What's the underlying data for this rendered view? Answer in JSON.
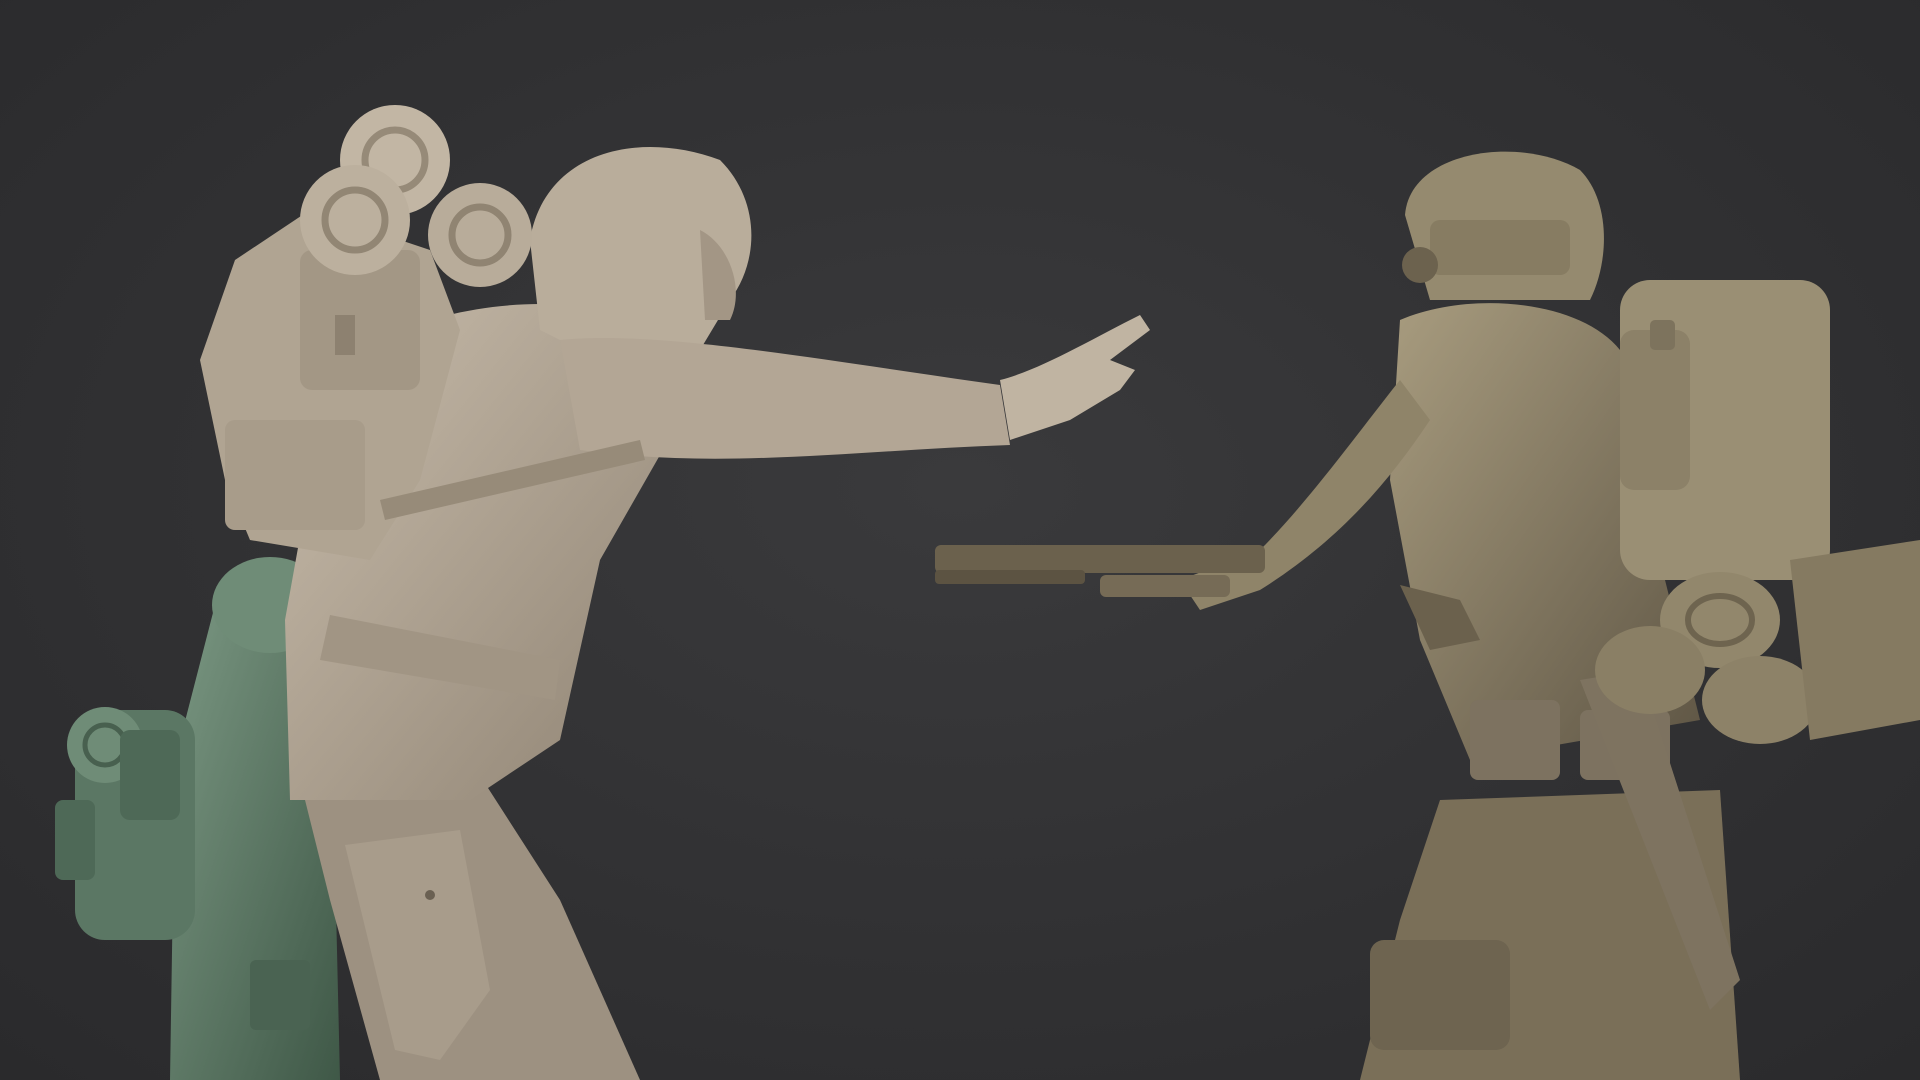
{
  "scene": {
    "background_color": "#323234",
    "figures": [
      {
        "name": "hooded-survivor",
        "color": "#b3a695"
      },
      {
        "name": "child-figure",
        "color": "#5e7a66"
      },
      {
        "name": "gasmask-soldier",
        "color": "#8d8167"
      }
    ]
  }
}
